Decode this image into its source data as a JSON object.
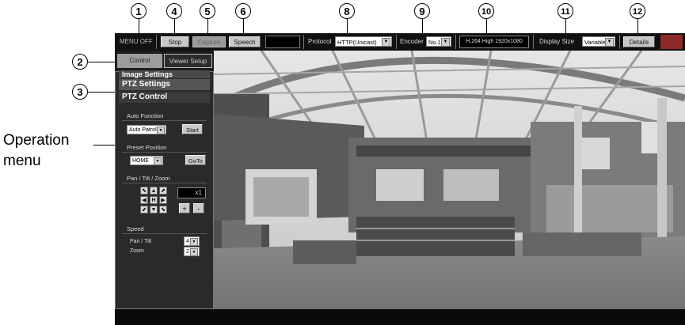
{
  "callouts": {
    "c1": "1",
    "c2": "2",
    "c3": "3",
    "c4": "4",
    "c5": "5",
    "c6": "6",
    "c8": "8",
    "c9": "9",
    "c10": "10",
    "c11": "11",
    "c12": "12"
  },
  "annotation": {
    "line1": "Operation",
    "line2": "menu"
  },
  "toolbar": {
    "menu_off_label": "MENU  OFF",
    "stop_label": "Stop",
    "capture_label": "Capture",
    "speech_label": "Speech",
    "protocol_label": "Protocol",
    "protocol_value": "HTTP(Unicast)",
    "encoder_label": "Encoder",
    "encoder_value": "No.1",
    "stream_info": "H.264 High 1920x1080",
    "display_size_label": "Display Size",
    "display_size_value": "Variable",
    "details_label": "Details"
  },
  "tabs": {
    "control": "Control",
    "viewer_setup": "Viewer Setup"
  },
  "panel": {
    "image_settings": "Image Settings",
    "ptz_settings": "PTZ Settings",
    "ptz_control": "PTZ Control",
    "auto_function_label": "Auto Function",
    "auto_function_value": "Auto Patrol",
    "start_label": "Start",
    "preset_position_label": "Preset Position",
    "preset_value": "HOME",
    "goto_label": "GoTo",
    "pan_tilt_zoom_label": "Pan / Tilt / Zoom",
    "zoom_readout": "x1",
    "zoom_plus": "+",
    "zoom_minus": "-",
    "speed_label": "Speed",
    "pan_tilt_label": "Pan / Tilt",
    "pan_tilt_value": "4",
    "zoom_label": "Zoom",
    "zoom_value": "2"
  },
  "directions": {
    "up_left": "⬉",
    "up": "▲",
    "up_right": "⬈",
    "left": "◀",
    "home": "H",
    "right": "▶",
    "down_left": "⬋",
    "down": "▼",
    "down_right": "⬊"
  },
  "colors": {
    "toolbar_bg": "#111111",
    "panel_bg": "#2a2a2a",
    "button_bg": "#c8c8c8"
  }
}
